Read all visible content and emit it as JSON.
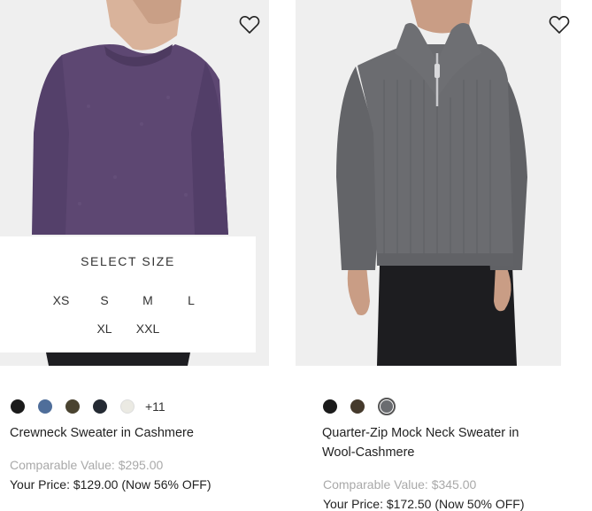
{
  "products": [
    {
      "name": "Crewneck Sweater in Cashmere",
      "comparable_label": "Comparable Value:",
      "comparable_value": "$295.00",
      "price_label": "Your Price:",
      "price_value": "$129.00",
      "discount": "(Now 56% OFF)",
      "size_panel": {
        "title": "SELECT SIZE",
        "sizes": [
          "XS",
          "S",
          "M",
          "L",
          "XL",
          "XXL"
        ]
      },
      "swatches": [
        "#1b1b1b",
        "#4f6e9a",
        "#4a4330",
        "#242a33",
        "#ebeae3"
      ],
      "more_colors": "+11"
    },
    {
      "name_line1": "Quarter-Zip Mock Neck Sweater in",
      "name_line2": "Wool-Cashmere",
      "comparable_label": "Comparable Value:",
      "comparable_value": "$345.00",
      "price_label": "Your Price:",
      "price_value": "$172.50",
      "discount": "(Now 50% OFF)",
      "swatches": [
        "#1b1b1b",
        "#453a2c",
        "#6a6c70"
      ],
      "selected_swatch_index": 2
    }
  ],
  "icons": {
    "wishlist": "heart-outline-icon"
  }
}
